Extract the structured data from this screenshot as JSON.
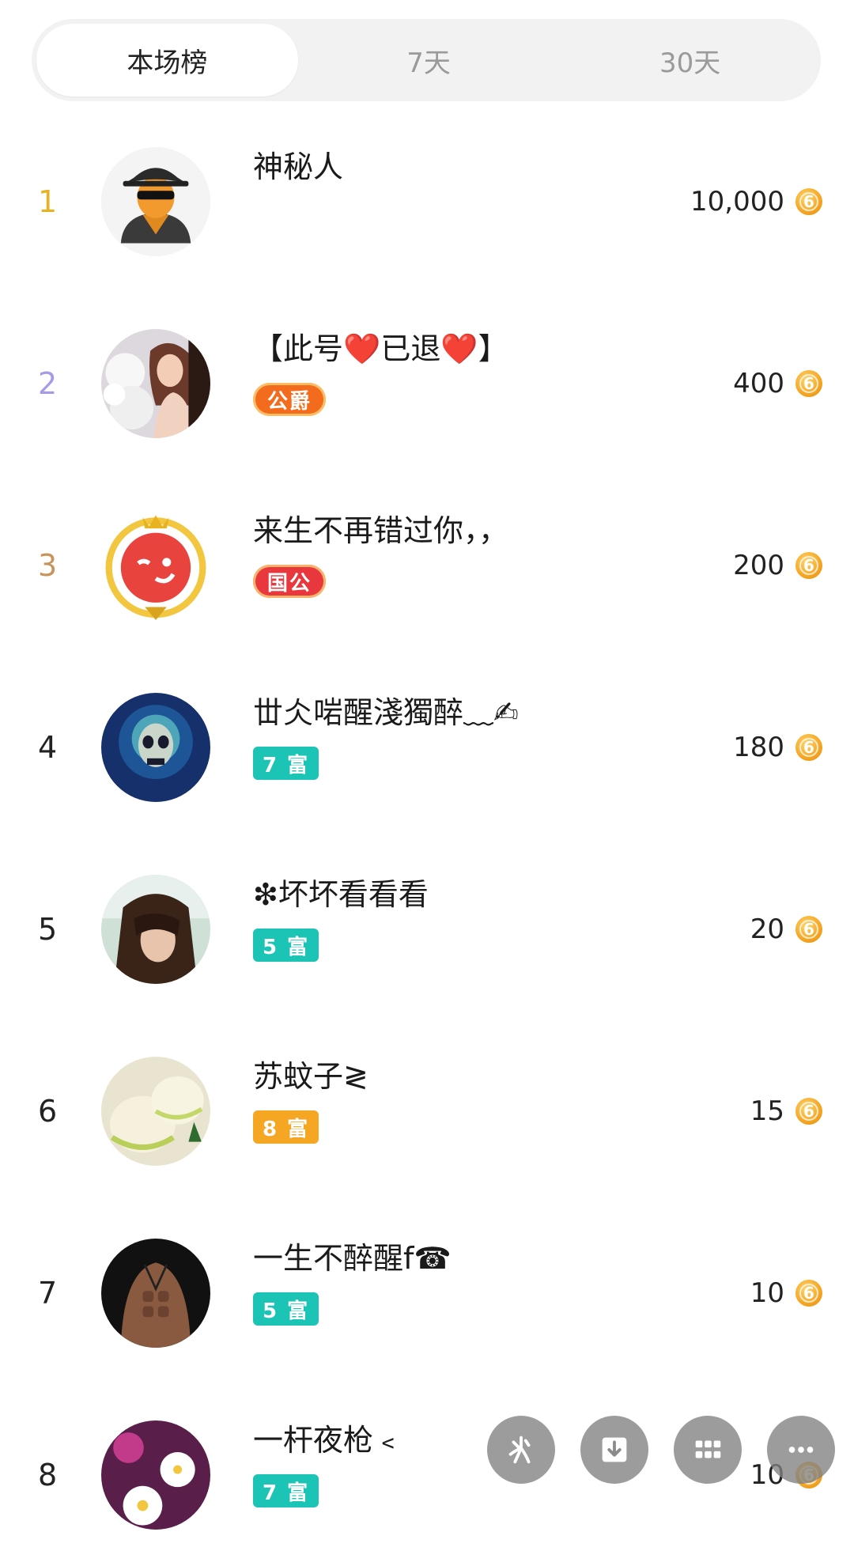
{
  "tabs": [
    {
      "label": "本场榜",
      "active": true
    },
    {
      "label": "7天",
      "active": false
    },
    {
      "label": "30天",
      "active": false
    }
  ],
  "colors": {
    "rank1": "#e6b422",
    "rank2": "#a59be6",
    "rank3": "#c8945c",
    "badge_teal": "#1cc4b5",
    "badge_orange": "#f5a623",
    "badge_noble_orange": "#f36b1c",
    "badge_noble_red": "#e8383d",
    "coin": "#f5a623"
  },
  "ranking": [
    {
      "rank": "1",
      "name": "神秘人",
      "badge": "",
      "score": "10,000",
      "avatar": "mystery-avatar"
    },
    {
      "rank": "2",
      "name": "【此号❤️已退❤️】",
      "badge": "公爵",
      "score": "400",
      "avatar": "girl-photo-avatar"
    },
    {
      "rank": "3",
      "name": "来生不再错过你，，",
      "badge": "国公",
      "score": "200",
      "avatar": "crowned-emoji-avatar"
    },
    {
      "rank": "4",
      "name": "丗仌啱醒淺獨醉﹏✍",
      "badge": "7 富",
      "score": "180",
      "avatar": "skull-avatar"
    },
    {
      "rank": "5",
      "name": "❇坏坏看看看",
      "badge": "5 富",
      "score": "20",
      "avatar": "girl-hair-avatar"
    },
    {
      "rank": "6",
      "name": "苏蚊子≷",
      "badge": "8 富",
      "score": "15",
      "avatar": "icecream-avatar"
    },
    {
      "rank": "7",
      "name": "一生不醉醒f☎",
      "badge": "5 富",
      "score": "10",
      "avatar": "abs-photo-avatar"
    },
    {
      "rank": "8",
      "name": "一杆夜枪﹤",
      "badge": "7 富",
      "score": "10",
      "avatar": "flower-avatar"
    }
  ],
  "coin_glyph": "6",
  "toolbar": [
    {
      "icon": "sparkle-icon"
    },
    {
      "icon": "download-icon"
    },
    {
      "icon": "grid-icon"
    },
    {
      "icon": "more-icon"
    }
  ]
}
